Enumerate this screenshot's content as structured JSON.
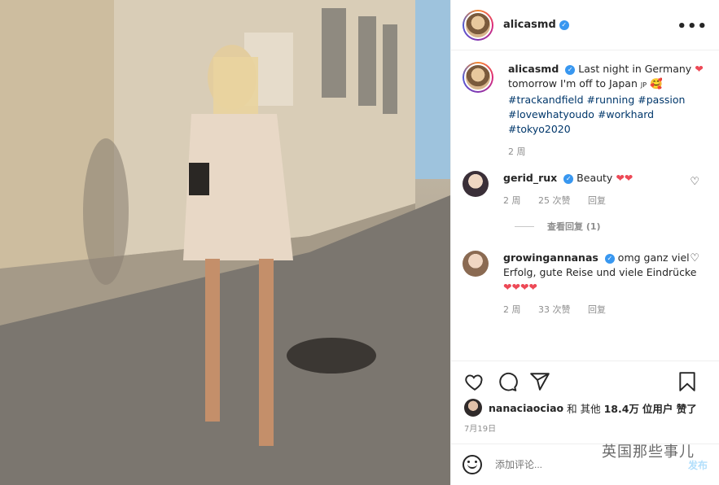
{
  "author": {
    "username": "alicasmd",
    "verified": true
  },
  "caption": {
    "username": "alicasmd",
    "text_line1": "Last night in Germany",
    "text_line2": "tomorrow I'm off to Japan",
    "flag": "JP",
    "hashtags": [
      "#trackandfield",
      "#running",
      "#passion",
      "#lovewhatyoudo",
      "#workhard",
      "#tokyo2020"
    ],
    "time": "2 周"
  },
  "comments": [
    {
      "username": "gerid_rux",
      "verified": true,
      "text": "Beauty",
      "time": "2 周",
      "likes": "25 次赞",
      "reply_label": "回复",
      "view_replies": "查看回复 (1)"
    },
    {
      "username": "growingannanas",
      "verified": true,
      "text": "omg ganz viel Erfolg, gute Reise und viele Eindrücke",
      "time": "2 周",
      "likes": "33 次赞",
      "reply_label": "回复"
    }
  ],
  "likes_line": {
    "user": "nanaciaociao",
    "middle": "和 其他",
    "count": "18.4万",
    "suffix": "位用户 赞了"
  },
  "post_date": "7月19日",
  "comment_input": {
    "placeholder": "添加评论...",
    "post_label": "发布"
  },
  "watermark": "英国那些事儿",
  "icons": {
    "more": "more-horizontal-icon",
    "like": "heart-icon",
    "comment": "comment-icon",
    "share": "paper-plane-icon",
    "save": "bookmark-icon",
    "emoji": "smiley-icon"
  },
  "colors": {
    "link": "#00376b",
    "verified": "#3897f0",
    "heart_red": "#ed4956",
    "muted": "#8e8e8e"
  }
}
